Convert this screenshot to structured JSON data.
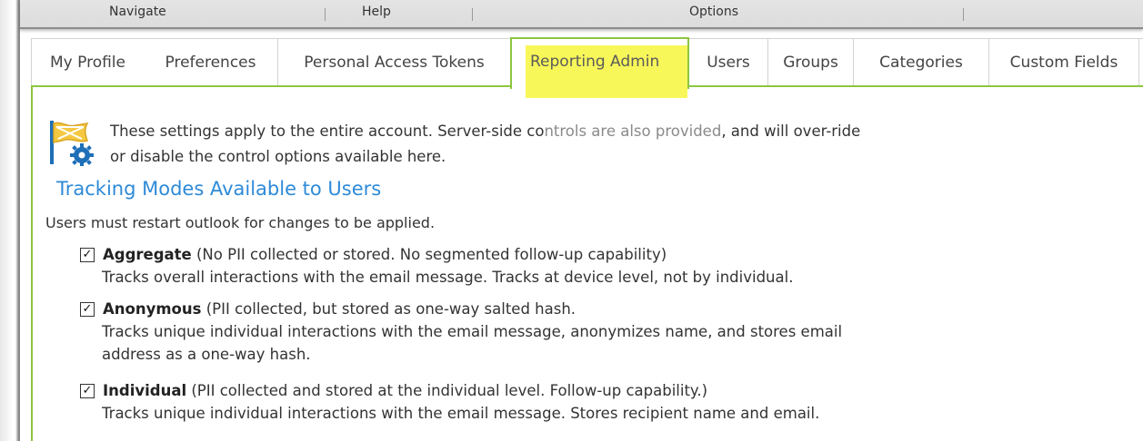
{
  "menu": {
    "navigate": "Navigate",
    "help": "Help",
    "options": "Options"
  },
  "tabs": [
    {
      "label": "My Profile"
    },
    {
      "label": "Preferences"
    },
    {
      "label": "Personal Access Tokens"
    },
    {
      "label": "Reporting Admin",
      "active": true
    },
    {
      "label": "Users"
    },
    {
      "label": "Groups"
    },
    {
      "label": "Categories"
    },
    {
      "label": "Custom Fields"
    }
  ],
  "intro": {
    "line1_a": "These settings apply to the entire account. Server-side co",
    "line1_b": "ntrols are also provided",
    "line1_c": ", and will over-ride",
    "line2": "or disable the control options available here."
  },
  "section_title": "Tracking Modes Available to Users",
  "note": "Users must restart outlook for changes to be applied.",
  "modes": [
    {
      "name": "Aggregate",
      "checked": true,
      "detail": " (No PII collected or stored. No segmented follow-up capability)",
      "desc": [
        "Tracks overall interactions with the email message. Tracks at device level, not by individual."
      ]
    },
    {
      "name": "Anonymous",
      "checked": true,
      "detail": " (PII collected, but stored as one-way salted hash.",
      "desc": [
        "Tracks unique individual interactions with the email message, anonymizes name, and stores email",
        "address as a one-way hash."
      ]
    },
    {
      "name": "Individual",
      "checked": true,
      "detail": " (PII collected and stored at the individual level. Follow-up capability.)",
      "desc": [
        "Tracks unique individual interactions with the email message. Stores recipient name and email."
      ]
    }
  ],
  "colors": {
    "accent_green": "#8cc63f",
    "title_blue": "#2e8ad8",
    "highlight_yellow": "#f6f52a"
  }
}
